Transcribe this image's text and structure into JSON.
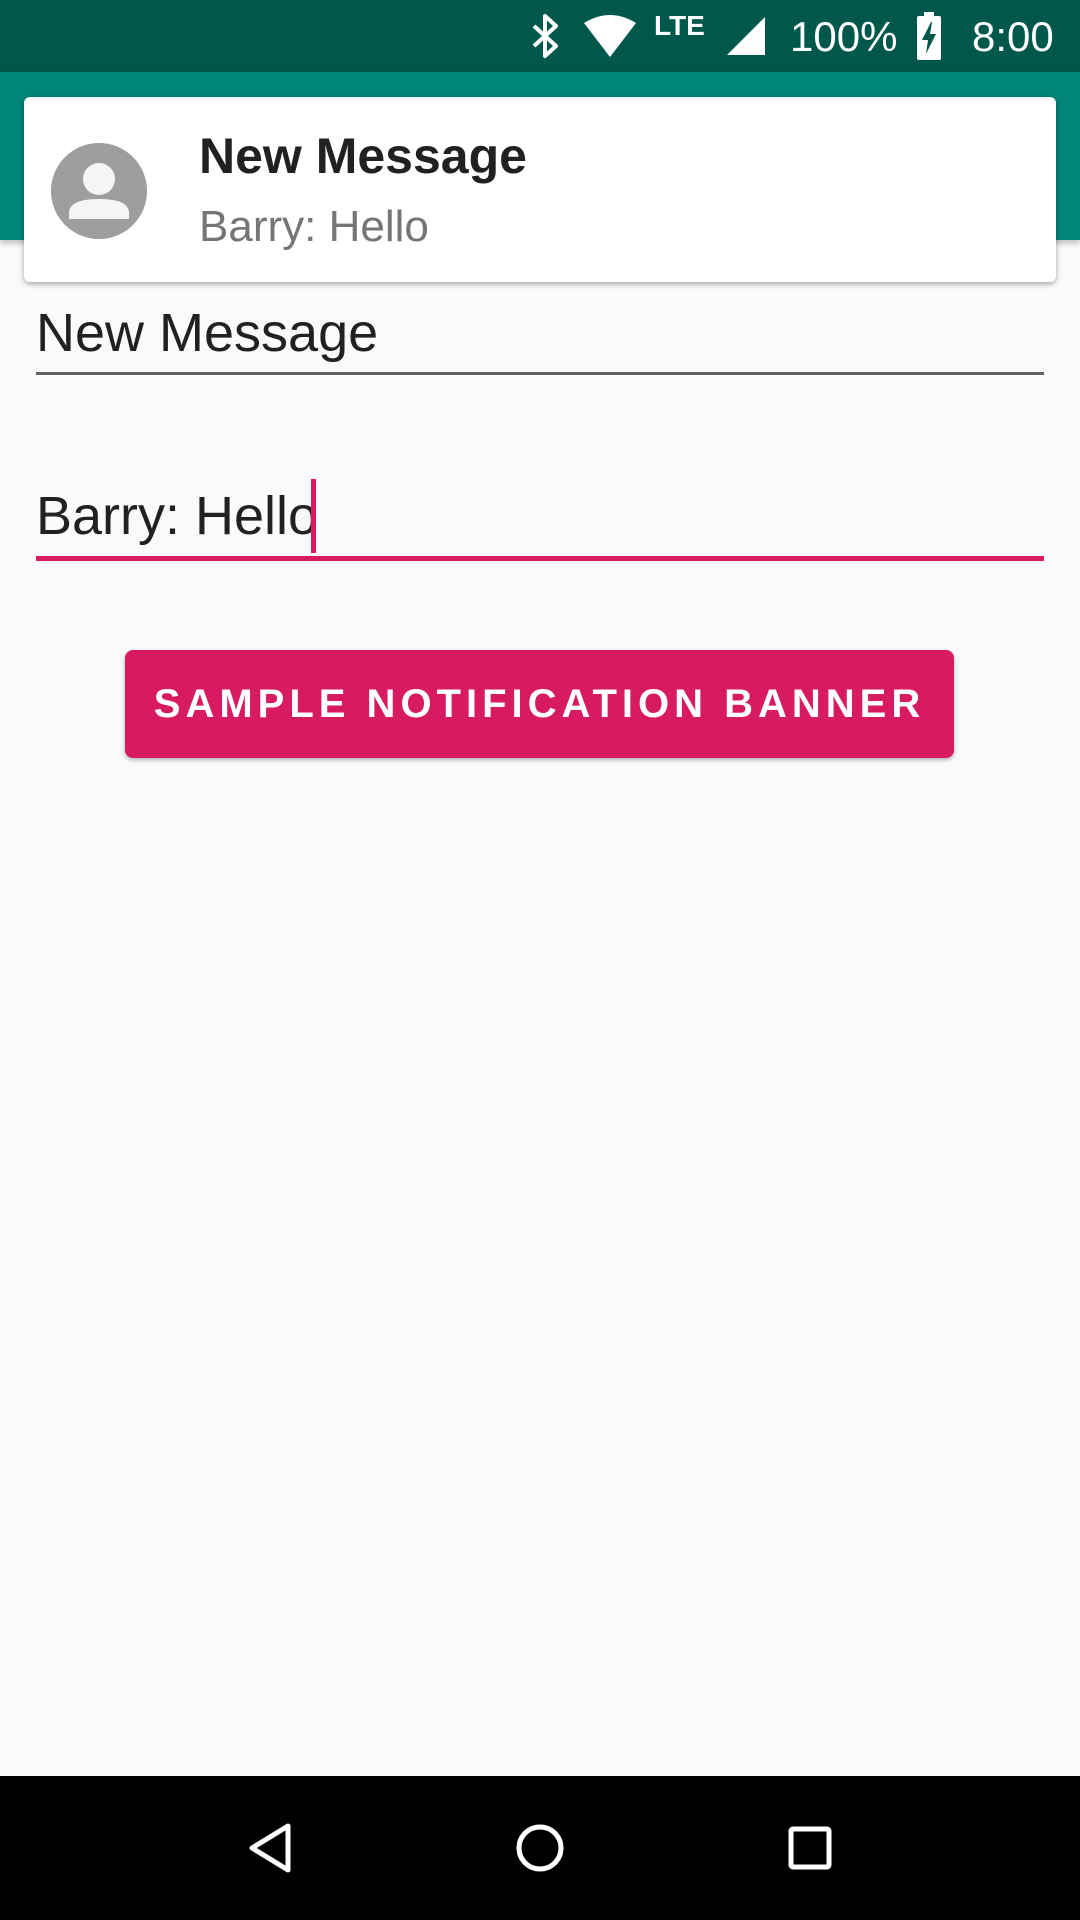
{
  "status_bar": {
    "network_type": "LTE",
    "battery_percent": "100%",
    "time": "8:00",
    "icons": [
      "bluetooth-icon",
      "wifi-icon",
      "signal-icon",
      "battery-charging-icon"
    ]
  },
  "notification": {
    "title": "New Message",
    "text": "Barry: Hello",
    "avatar_icon": "person-icon"
  },
  "form": {
    "title_field": {
      "value": "New Message"
    },
    "message_field": {
      "value": "Barry: Hello"
    },
    "button_label": "SAMPLE NOTIFICATION BANNER"
  },
  "nav_bar": {
    "icons": [
      "back-icon",
      "home-icon",
      "recents-icon"
    ]
  },
  "colors": {
    "status_bar": "#00574b",
    "primary": "#008577",
    "accent": "#d81b60",
    "background": "#fafafa"
  }
}
